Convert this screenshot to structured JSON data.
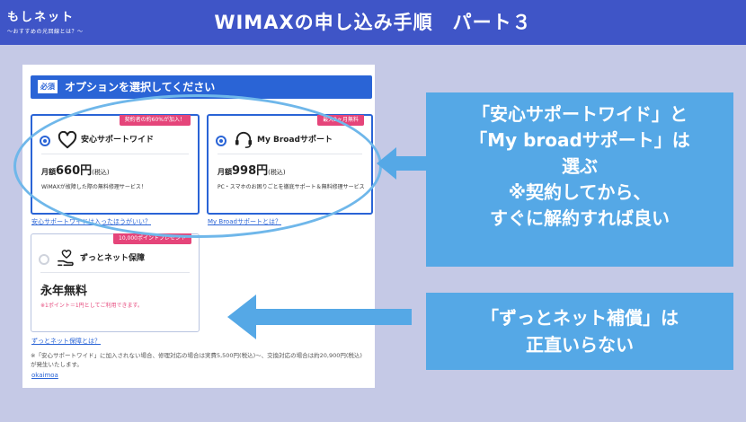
{
  "header": {
    "logo_main": "もしネット",
    "logo_sub": "〜おすすめの光回線とは？〜",
    "title": "WIMAXの申し込み手順　パート３"
  },
  "screenshot": {
    "section_badge": "必須",
    "section_title": "オプションを選択してください",
    "cards": [
      {
        "name": "安心サポートワイド",
        "ribbon": "契約者の約60%が加入！",
        "price_prefix": "月額",
        "price": "660円",
        "tax": "(税込)",
        "desc": "WiMAXが故障した際の無料修理サービス！",
        "selected": true,
        "icon": "heart-icon"
      },
      {
        "name": "My Broadサポート",
        "ribbon": "最大2ヶ月無料",
        "price_prefix": "月額",
        "price": "998円",
        "tax": "(税込)",
        "desc": "PC・スマホのお困りごとを徹底サポート＆無料修理サービス",
        "selected": true,
        "icon": "headset-icon"
      },
      {
        "name": "ずっとネット保障",
        "ribbon": "10,000ポイントプレゼント",
        "price": "永年無料",
        "desc": "※1ポイント＝1円としてご利用できます。",
        "selected": false,
        "icon": "hand-heart-icon"
      }
    ],
    "links": {
      "anshin": "安心サポートワイドは入ったほうがいい？",
      "mybroad": "My Broadサポートとは？",
      "zutto": "ずっとネット保障とは？"
    },
    "note_1": "※「安心サポートワイド」に加入されない場合、修理対応の場合は実費5,500円(税込)〜、交換対応の場合は約20,900円(税込)",
    "note_2": "が発生いたします。",
    "footer_logo": "okaimoa"
  },
  "callouts": {
    "right_top": [
      "「安心サポートワイド」と",
      "「My broadサポート」は",
      "選ぶ",
      "※契約してから、",
      "すぐに解約すれば良い"
    ],
    "right_bottom": [
      "「ずっとネット補償」は",
      "正直いらない"
    ]
  },
  "colors": {
    "header_bg": "#3f55c7",
    "page_bg": "#c5c9e6",
    "accent_blue": "#2a64d6",
    "callout_bg": "#55a8e6",
    "ribbon_pink": "#e5457a",
    "ellipse": "#6fb7ea"
  }
}
